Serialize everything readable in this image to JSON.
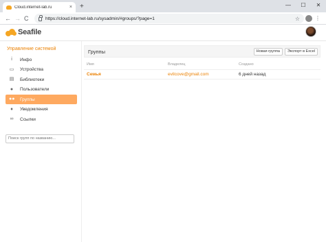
{
  "browser": {
    "tab_title": "Cloud.internet-lab.ru",
    "tab_close": "×",
    "new_tab": "+",
    "url": "https://cloud.internet-lab.ru/sysadmin/#groups/?page=1",
    "win_minimize": "—",
    "win_maximize": "☐",
    "win_close": "✕",
    "back": "←",
    "forward": "→",
    "reload": "C",
    "star": "☆",
    "menu": "⋮"
  },
  "app": {
    "logo_text": "Seafile"
  },
  "sidebar": {
    "title": "Управление системой",
    "items": [
      {
        "label": "Инфо",
        "icon": "info-icon",
        "glyph": "i"
      },
      {
        "label": "Устройства",
        "icon": "monitor-icon",
        "glyph": "▭"
      },
      {
        "label": "Библиотеки",
        "icon": "library-icon",
        "glyph": "▤"
      },
      {
        "label": "Пользователи",
        "icon": "user-icon",
        "glyph": "●"
      },
      {
        "label": "Группы",
        "icon": "group-icon",
        "glyph": "●●"
      },
      {
        "label": "Уведомления",
        "icon": "bell-icon",
        "glyph": "♦"
      },
      {
        "label": "Ссылки",
        "icon": "link-icon",
        "glyph": "∞"
      }
    ],
    "active_index": 4,
    "search_placeholder": "Поиск групп по названию..."
  },
  "main": {
    "title": "Группы",
    "new_group_button": "Новая группа",
    "export_button": "Экспорт в Excel",
    "columns": [
      "Имя",
      "Владелец",
      "Создано"
    ],
    "rows": [
      {
        "name": "Семья",
        "owner": "evilcove@gmail.com",
        "created": "6 дней назад"
      }
    ]
  },
  "colors": {
    "accent": "#eb8205",
    "active_bg": "#fea960"
  }
}
